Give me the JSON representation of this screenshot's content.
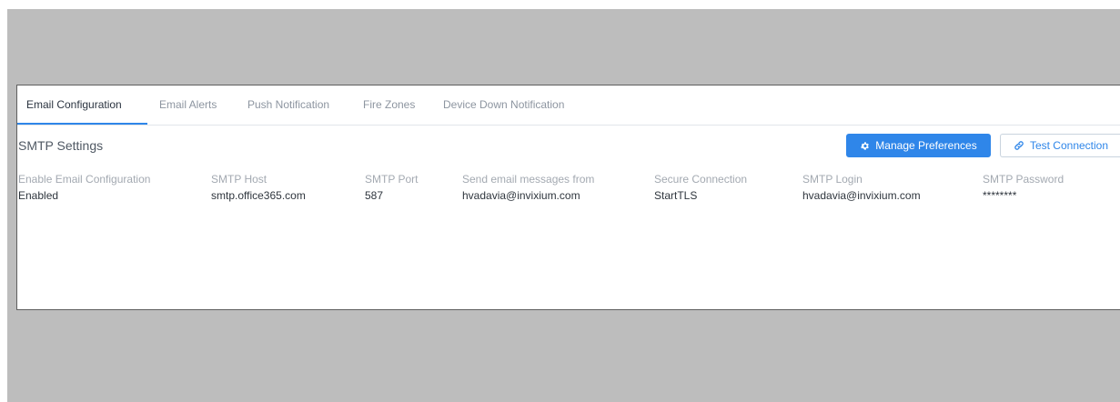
{
  "tabs": [
    {
      "label": "Email Configuration",
      "active": true
    },
    {
      "label": "Email Alerts",
      "active": false
    },
    {
      "label": "Push Notification",
      "active": false
    },
    {
      "label": "Fire Zones",
      "active": false
    },
    {
      "label": "Device Down Notification",
      "active": false
    }
  ],
  "section": {
    "title": "SMTP Settings"
  },
  "buttons": {
    "manage_preferences": {
      "label": "Manage Preferences",
      "icon": "gear-icon"
    },
    "test_connection": {
      "label": "Test Connection",
      "icon": "link-icon"
    }
  },
  "fields": [
    {
      "label": "Enable Email Configuration",
      "value": "Enabled"
    },
    {
      "label": "SMTP Host",
      "value": "smtp.office365.com"
    },
    {
      "label": "SMTP Port",
      "value": "587"
    },
    {
      "label": "Send email messages from",
      "value": "hvadavia@invixium.com"
    },
    {
      "label": "Secure Connection",
      "value": "StartTLS"
    },
    {
      "label": "SMTP Login",
      "value": "hvadavia@invixium.com"
    },
    {
      "label": "SMTP Password",
      "value": "********"
    }
  ],
  "colors": {
    "accent": "#2f86e9",
    "backdrop": "#bdbdbd",
    "panel": "#ffffff"
  }
}
